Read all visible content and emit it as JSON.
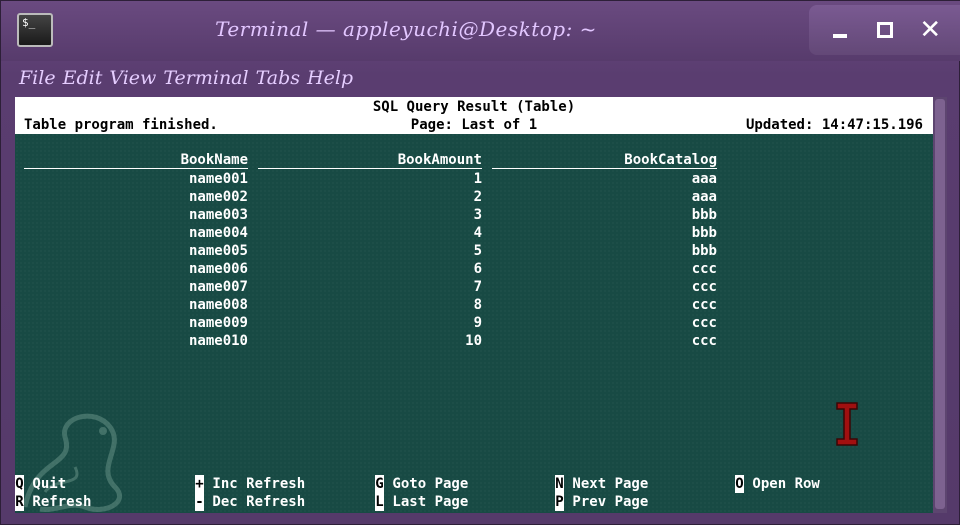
{
  "window": {
    "title": "Terminal — appleyuchi@Desktop: ~",
    "icon_text": "$_",
    "minimize_icon": "minimize-icon",
    "maximize_icon": "maximize-icon",
    "close_label": "✕"
  },
  "menu": [
    "File",
    "Edit",
    "View",
    "Terminal",
    "Tabs",
    "Help"
  ],
  "header": {
    "title": "SQL Query Result (Table)",
    "status": "Table program finished.",
    "page": "Page: Last of 1",
    "updated": "Updated: 14:47:15.196"
  },
  "table": {
    "columns": [
      "BookName",
      "BookAmount",
      "BookCatalog"
    ],
    "rows": [
      [
        "name001",
        "1",
        "aaa"
      ],
      [
        "name002",
        "2",
        "aaa"
      ],
      [
        "name003",
        "3",
        "bbb"
      ],
      [
        "name004",
        "4",
        "bbb"
      ],
      [
        "name005",
        "5",
        "bbb"
      ],
      [
        "name006",
        "6",
        "ccc"
      ],
      [
        "name007",
        "7",
        "ccc"
      ],
      [
        "name008",
        "8",
        "ccc"
      ],
      [
        "name009",
        "9",
        "ccc"
      ],
      [
        "name010",
        "10",
        "ccc"
      ]
    ]
  },
  "footer": [
    {
      "key": "Q",
      "label": " Quit"
    },
    {
      "key": "R",
      "label": " Refresh"
    },
    {
      "key": "+",
      "label": " Inc Refresh"
    },
    {
      "key": "-",
      "label": " Dec Refresh"
    },
    {
      "key": "G",
      "label": " Goto Page"
    },
    {
      "key": "L",
      "label": " Last Page"
    },
    {
      "key": "N",
      "label": " Next Page"
    },
    {
      "key": "P",
      "label": " Prev Page"
    },
    {
      "key": "O",
      "label": " Open Row"
    }
  ],
  "colors": {
    "terminal_bg": "#184a44",
    "window_frame": "#5a3d70",
    "title_text": "#e2c6ff",
    "cursor": "#a01010"
  }
}
